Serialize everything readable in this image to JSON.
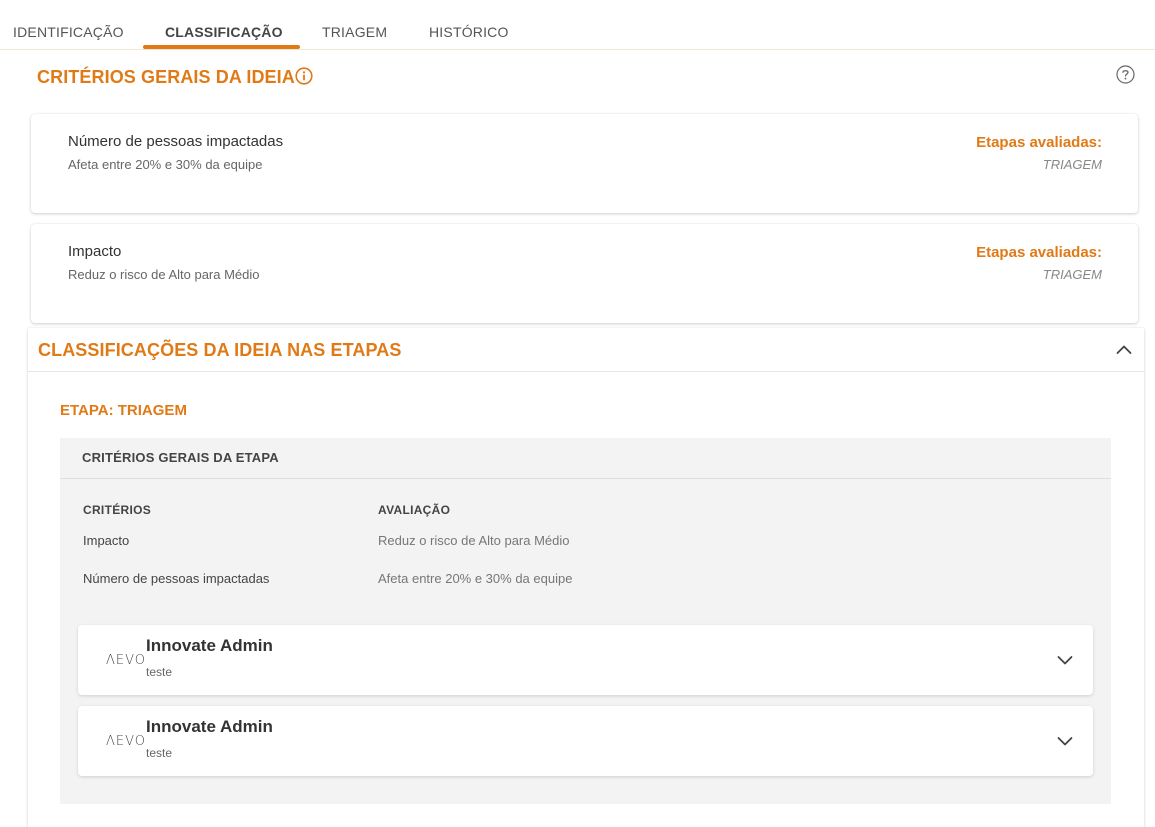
{
  "tabs": [
    {
      "label": "IDENTIFICAÇÃO",
      "active": false
    },
    {
      "label": "CLASSIFICAÇÃO",
      "active": true
    },
    {
      "label": "TRIAGEM",
      "active": false
    },
    {
      "label": "HISTÓRICO",
      "active": false
    }
  ],
  "colors": {
    "accent": "#e07a16",
    "panel_gray": "#f3f3f3"
  },
  "general_criteria": {
    "title": "CRITÉRIOS GERAIS DA IDEIA",
    "info_icon": "info-circle-icon",
    "help_icon": "question-circle-icon",
    "items": [
      {
        "name": "Número de pessoas impactadas",
        "value": "Afeta entre 20% e 30% da equipe",
        "steps_label": "Etapas avaliadas:",
        "steps": "TRIAGEM"
      },
      {
        "name": "Impacto",
        "value": "Reduz o risco de Alto para Médio",
        "steps_label": "Etapas avaliadas:",
        "steps": "TRIAGEM"
      }
    ]
  },
  "stage_classifications": {
    "title": "CLASSIFICAÇÕES DA IDEIA NAS ETAPAS",
    "collapse_icon": "chevron-up-icon",
    "stage_label": "ETAPA: TRIAGEM",
    "box_title": "CRITÉRIOS GERAIS DA ETAPA",
    "columns": {
      "criteria": "CRITÉRIOS",
      "evaluation": "AVALIAÇÃO"
    },
    "rows": [
      {
        "criterion": "Impacto",
        "evaluation": "Reduz o risco de Alto para Médio"
      },
      {
        "criterion": "Número de pessoas impactadas",
        "evaluation": "Afeta entre 20% e 30% da equipe"
      }
    ],
    "evaluators": [
      {
        "logo": "ΛEVO",
        "name": "Innovate Admin",
        "comment": "teste",
        "expand_icon": "chevron-down-icon"
      },
      {
        "logo": "ΛEVO",
        "name": "Innovate Admin",
        "comment": "teste",
        "expand_icon": "chevron-down-icon"
      }
    ]
  }
}
